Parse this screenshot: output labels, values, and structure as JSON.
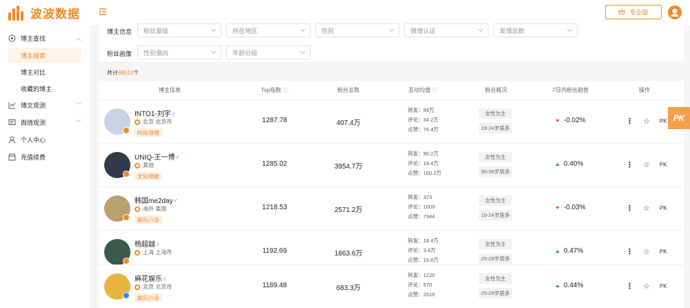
{
  "app": {
    "logo_text": "波波数据",
    "pro_label": "专业版",
    "accent": "#f08a24"
  },
  "sidebar": {
    "groups": [
      {
        "label": "博主查找",
        "icon": "compass-icon",
        "expanded": true,
        "children": [
          "博主搜索",
          "博主对比",
          "收藏的博主"
        ]
      },
      {
        "label": "博文观测",
        "icon": "chart-icon"
      },
      {
        "label": "舆情观测",
        "icon": "monitor-icon"
      },
      {
        "label": "个人中心",
        "icon": "user-icon"
      },
      {
        "label": "充值续费",
        "icon": "shop-icon"
      }
    ],
    "active_child": "博主搜索"
  },
  "filters": {
    "row1_label": "博主信息",
    "row1": [
      "粉丝量级",
      "所在地区",
      "性别",
      "微博认证",
      "发博总数"
    ],
    "row2_label": "粉丝画像",
    "row2": [
      "性别偏向",
      "年龄分段"
    ]
  },
  "total": {
    "prefix": "共计",
    "count": "69512",
    "suffix": "个"
  },
  "table": {
    "headers": [
      "博主信息",
      "Top指数",
      "粉丝总数",
      "互动均值",
      "粉丝概况",
      "7日内粉丝趋势",
      "操作"
    ],
    "rows": [
      {
        "name": "INTO1-刘宇",
        "gender": "♂",
        "location": "北京 北京市",
        "tag": "时尚/穿搭",
        "top_index": "1287.78",
        "fans": "407.4万",
        "reposts": "转发：59万",
        "comments": "评论：34.2万",
        "likes": "点赞：70.4万",
        "fans_gender": "女性为主",
        "fans_age": "19-24岁居多",
        "trend": "-0.02%",
        "trend_dir": "down",
        "avatar_color": "#c9d3e6"
      },
      {
        "name": "UNIQ-王一博",
        "gender": "♂",
        "location": "其他",
        "tag": "文化/明星",
        "top_index": "1285.02",
        "fans": "3954.7万",
        "reposts": "转发：90.2万",
        "comments": "评论：19.4万",
        "likes": "点赞：160.2万",
        "fans_gender": "女性为主",
        "fans_age": "30-39岁居多",
        "trend": "0.40%",
        "trend_dir": "up",
        "avatar_color": "#2f3a4a"
      },
      {
        "name": "韩国me2day",
        "gender": "♂",
        "location": "海外 美国",
        "tag": "娱乐/八卦",
        "top_index": "1218.53",
        "fans": "2571.2万",
        "reposts": "转发：373",
        "comments": "评论：1003",
        "likes": "点赞：7944",
        "fans_gender": "女性为主",
        "fans_age": "19-24岁居多",
        "trend": "-0.03%",
        "trend_dir": "down",
        "avatar_color": "#b8a070"
      },
      {
        "name": "杨超越",
        "gender": "♀",
        "location": "上海 上海市",
        "tag": "",
        "top_index": "1192.69",
        "fans": "1863.6万",
        "reposts": "转发：18.4万",
        "comments": "评论：3.9万",
        "likes": "点赞：15.8万",
        "fans_gender": "女性为主",
        "fans_age": "25-29岁居多",
        "trend": "0.47%",
        "trend_dir": "up",
        "avatar_color": "#3a5a4a"
      },
      {
        "name": "麻花娱乐",
        "gender": "♀",
        "location": "北京 北京市",
        "tag": "娱乐/八卦",
        "top_index": "1189.48",
        "fans": "683.3万",
        "reposts": "转发：1220",
        "comments": "评论：570",
        "likes": "点赞：2510",
        "fans_gender": "女性为主",
        "fans_age": "25-29岁居多",
        "trend": "0.44%",
        "trend_dir": "up",
        "avatar_color": "#e8b640"
      }
    ],
    "op_pk": "PK"
  },
  "pk_float": "PK"
}
